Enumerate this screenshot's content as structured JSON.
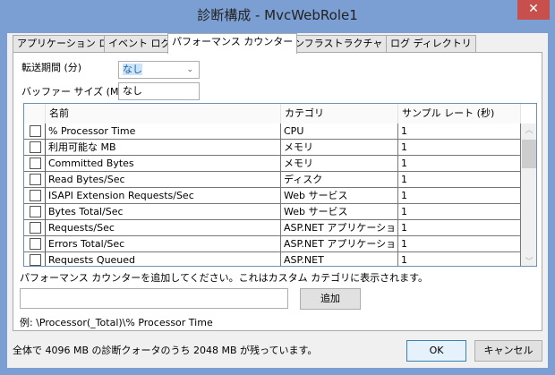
{
  "window": {
    "title": "診断構成 - MvcWebRole1",
    "close": "✕"
  },
  "tabs": [
    {
      "label": "アプリケーション ログ"
    },
    {
      "label": "イベント ログ"
    },
    {
      "label": "パフォーマンス カウンター",
      "active": true
    },
    {
      "label": "インフラストラクチャ ログ"
    },
    {
      "label": "ログ ディレクトリ"
    }
  ],
  "form": {
    "transfer_label": "転送期間 (分)",
    "transfer_value": "なし",
    "buffer_label": "バッファー サイズ (MB)",
    "buffer_value": "なし"
  },
  "grid": {
    "columns": [
      "名前",
      "カテゴリ",
      "サンプル レート (秒)"
    ],
    "rows": [
      {
        "name": "% Processor Time",
        "category": "CPU",
        "rate": "1",
        "checked": false
      },
      {
        "name": "利用可能な MB",
        "category": "メモリ",
        "rate": "1",
        "checked": false
      },
      {
        "name": "Committed Bytes",
        "category": "メモリ",
        "rate": "1",
        "checked": false
      },
      {
        "name": "Read Bytes/Sec",
        "category": "ディスク",
        "rate": "1",
        "checked": false
      },
      {
        "name": "ISAPI Extension Requests/Sec",
        "category": "Web サービス",
        "rate": "1",
        "checked": false
      },
      {
        "name": "Bytes Total/Sec",
        "category": "Web サービス",
        "rate": "1",
        "checked": false
      },
      {
        "name": "Requests/Sec",
        "category": "ASP.NET アプリケーション",
        "rate": "1",
        "checked": false
      },
      {
        "name": "Errors Total/Sec",
        "category": "ASP.NET アプリケーション",
        "rate": "1",
        "checked": false
      },
      {
        "name": "Requests Queued",
        "category": "ASP.NET",
        "rate": "1",
        "checked": false
      }
    ]
  },
  "add": {
    "hint": "パフォーマンス カウンターを追加してください。これはカスタム カテゴリに表示されます。",
    "input_value": "",
    "button": "追加",
    "example": "例: \\Processor(_Total)\\% Processor Time"
  },
  "footer": {
    "status": "全体で 4096 MB の診断クォータのうち 2048 MB が残っています。",
    "ok": "OK",
    "cancel": "キャンセル"
  }
}
